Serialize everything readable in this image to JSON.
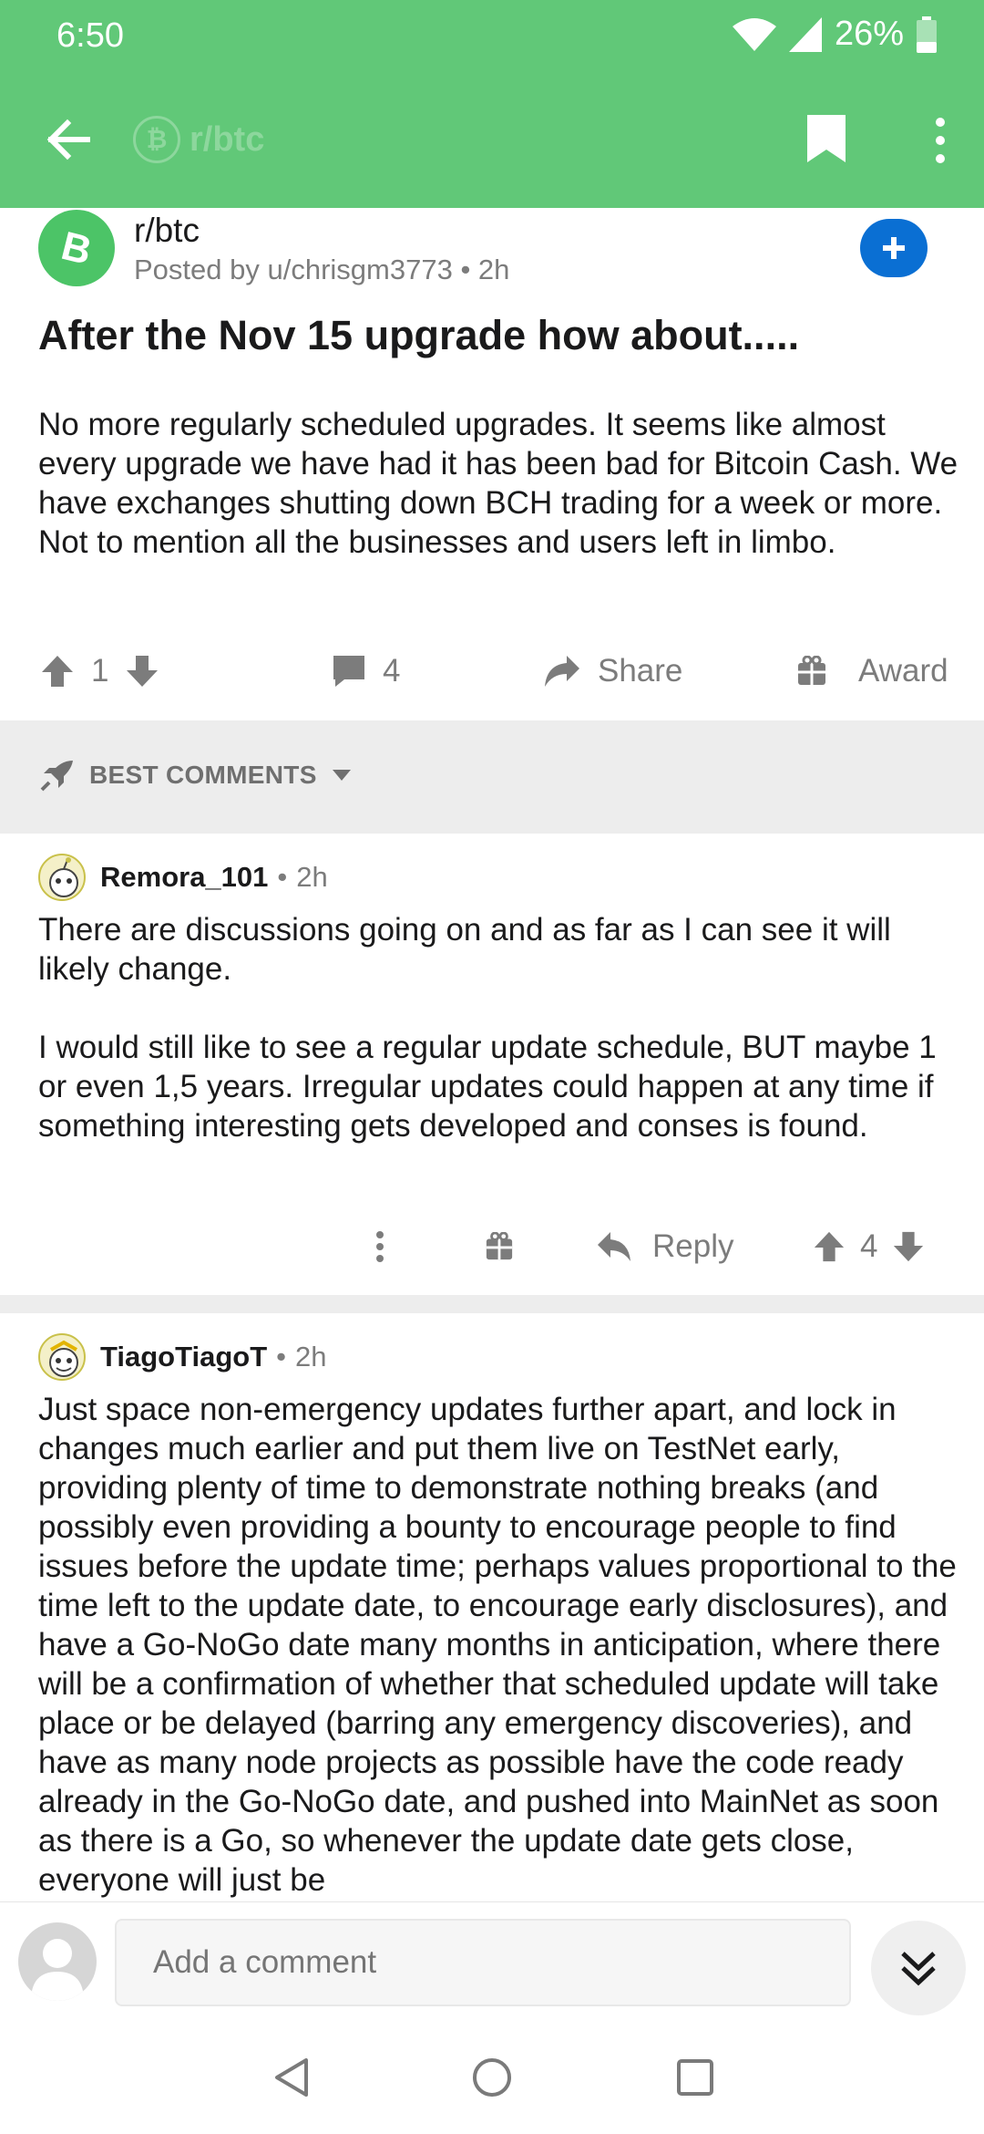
{
  "status_bar": {
    "time": "6:50",
    "battery": "26%"
  },
  "toolbar": {
    "subreddit": "r/btc"
  },
  "post": {
    "subreddit": "r/btc",
    "posted_by": "Posted by u/chrisgm3773",
    "age": "2h",
    "title": "After the Nov 15 upgrade how about.....",
    "body": "No more regularly scheduled upgrades. It seems like almost every upgrade we have had  it has been bad for Bitcoin Cash. We have exchanges  shutting down BCH trading for a week or more. Not to mention all the businesses and users left in limbo.",
    "votes": "1",
    "comments": "4",
    "share_label": "Share",
    "award_label": "Award"
  },
  "sort": {
    "label": "BEST COMMENTS"
  },
  "comments": [
    {
      "user": "Remora_101",
      "age": "2h",
      "paragraphs": [
        "There are discussions going on and as far as I can see it will likely change.",
        "I would still like to see a regular update schedule, BUT maybe 1 or even 1,5 years. Irregular updates could happen at any time if something interesting gets developed and conses is found."
      ],
      "reply_label": "Reply",
      "votes": "4"
    },
    {
      "user": "TiagoTiagoT",
      "age": "2h",
      "paragraphs": [
        "Just space non-emergency updates further apart, and lock in changes much earlier and put them live on TestNet early, providing plenty of time to demonstrate nothing breaks (and possibly even providing a bounty to encourage people to find issues before the update time; perhaps values proportional to the time left to the update date, to encourage early disclosures), and have a Go-NoGo date many months in anticipation, where there will be a confirmation of whether that scheduled update will take place or be delayed (barring any emergency discoveries), and have as many node projects as possible have the code ready already in the Go-NoGo date, and pushed into MainNet as soon as there is a  Go, so whenever the update date gets close, everyone will just be"
      ]
    }
  ],
  "composer": {
    "placeholder": "Add a comment"
  },
  "colors": {
    "header": "#61c878",
    "join": "#0a6fd3",
    "muted": "#7c7c7c",
    "band": "#ededed"
  }
}
